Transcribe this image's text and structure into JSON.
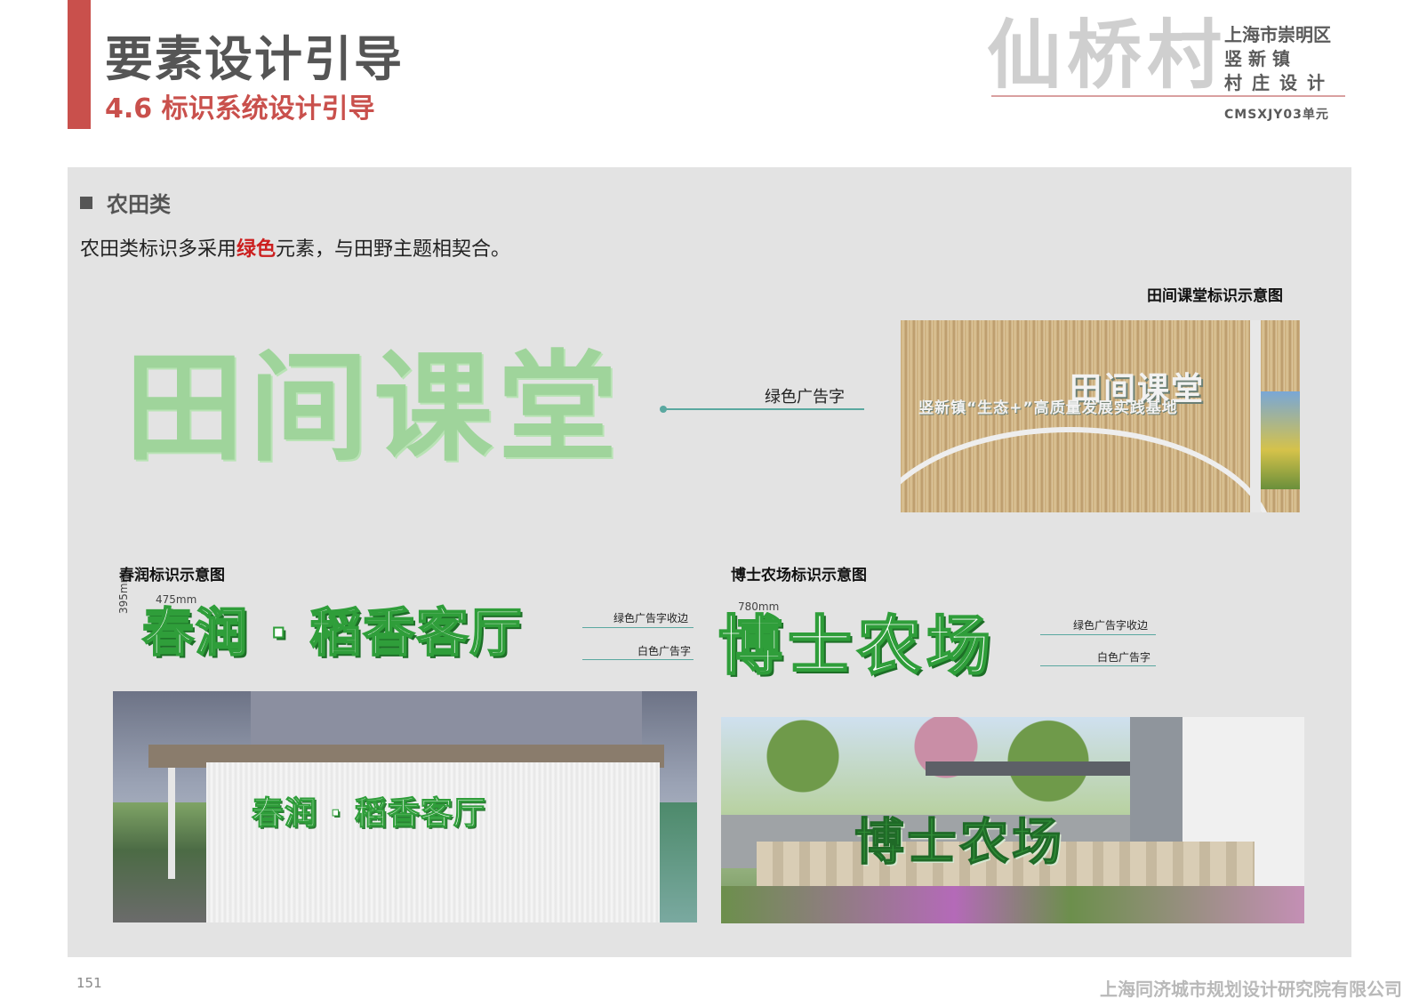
{
  "header": {
    "title": "要素设计引导",
    "subtitle": "4.6 标识系统设计引导"
  },
  "brand": {
    "name": "仙桥村",
    "line1": "上海市崇明区",
    "line2": "竖 新 镇",
    "line3": "村庄设计",
    "code": "CMSXJY03单元"
  },
  "section": {
    "heading": "农田类",
    "desc_before": "农田类标识多采用",
    "desc_highlight": "绿色",
    "desc_after": "元素，与田野主题相契合。",
    "highlight_color": "#cc1f1f"
  },
  "figures": {
    "tianjian": {
      "caption": "田间课堂标识示意图",
      "sign_text": "田间课堂",
      "annotation": "绿色广告字",
      "photo_sign_line": "竖新镇“生态+”高质量发展实践基地"
    },
    "chunrun": {
      "caption": "春润标识示意图",
      "sign_text": "春润 · 稻香客厅",
      "width_dim": "475mm",
      "height_dim": "395mm",
      "anno_edge": "绿色广告字收边",
      "anno_face": "白色广告字"
    },
    "boshi": {
      "caption": "博士农场标识示意图",
      "sign_text": "博士农场",
      "width_dim": "780mm",
      "anno_edge": "绿色广告字收边",
      "anno_face": "白色广告字"
    }
  },
  "colors": {
    "accent": "#c9504c",
    "sign_green": "#2f9e3a",
    "soft_green": "#9fd49b",
    "panel": "#e3e3e3"
  },
  "footer": {
    "page_number": "151",
    "organization": "上海同济城市规划设计研究院有限公司"
  }
}
